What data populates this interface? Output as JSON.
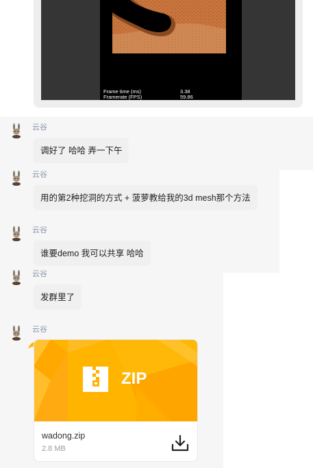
{
  "image_message": {
    "stats": [
      {
        "label": "Frame time (ms)",
        "value": "3.38"
      },
      {
        "label": "Framerate (FPS)",
        "value": "59.86"
      }
    ]
  },
  "messages": [
    {
      "sender": "云谷",
      "text": "调好了 哈哈 弄一下午"
    },
    {
      "sender": "云谷",
      "text": "用的第2种挖洞的方式 + 菠萝教给我的3d mesh那个方法"
    },
    {
      "sender": "云谷",
      "text": "谁要demo 我可以共享 哈哈"
    },
    {
      "sender": "云谷",
      "text": "发群里了"
    },
    {
      "sender": "云谷",
      "text": ""
    }
  ],
  "file": {
    "type_label": "ZIP",
    "name": "wadong.zip",
    "size": "2.8 MB",
    "banner_color": "#ffb400"
  },
  "colors": {
    "sender": "#8a94a8",
    "bubble": "#f0f0f0",
    "accent": "#ffb400"
  },
  "icons": {
    "avatar": "rabbit-avatar-icon",
    "zip": "zip-file-icon",
    "download": "download-icon"
  }
}
